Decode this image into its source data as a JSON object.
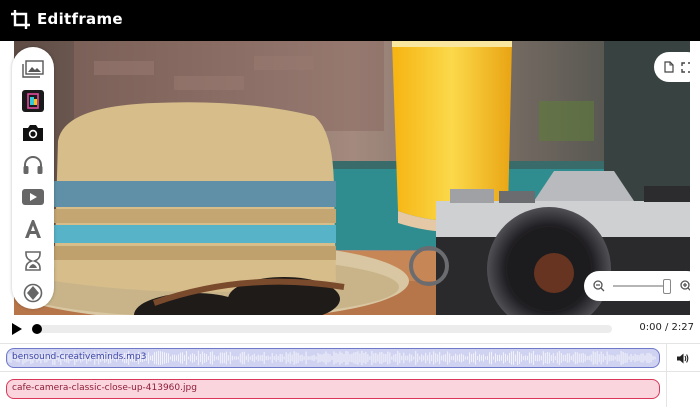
{
  "app": {
    "title": "Editframe",
    "logo_icon": "crop-icon"
  },
  "toolbar": {
    "tools": [
      {
        "icon": "media-library-icon"
      },
      {
        "icon": "templates-icon",
        "selected": true
      },
      {
        "icon": "camera-icon"
      },
      {
        "icon": "headphones-icon"
      },
      {
        "icon": "video-icon"
      },
      {
        "icon": "text-icon"
      },
      {
        "icon": "hourglass-icon"
      },
      {
        "icon": "filter-icon"
      }
    ]
  },
  "view_controls": {
    "icons": [
      "page-icon",
      "fullscreen-icon"
    ]
  },
  "zoom": {
    "icons": [
      "zoom-out-icon",
      "zoom-in-icon"
    ],
    "level": 0.92
  },
  "playback": {
    "time": "0:00 / 2:27",
    "progress": 0
  },
  "tracks": {
    "audio": {
      "label": "bensound-creativeminds.mp3",
      "icon": "speaker-icon"
    },
    "image": {
      "label": "cafe-camera-classic-close-up-413960.jpg"
    }
  },
  "colors": {
    "topbar": "#000000",
    "audio_clip": "#cfd2f0",
    "image_clip": "#fbd5dd"
  }
}
